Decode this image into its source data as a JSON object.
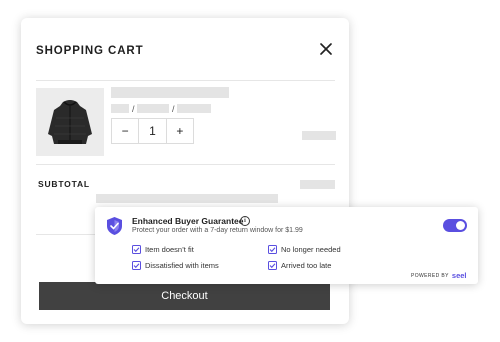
{
  "cart": {
    "title": "SHOPPING CART",
    "quantity": {
      "decrement": "−",
      "value": "1",
      "increment": "+"
    },
    "variant_separators": [
      "/",
      "/"
    ],
    "subtotal_label": "SUBTOTAL",
    "checkout_label": "Checkout"
  },
  "protection": {
    "title": "Enhanced Buyer Guarantee",
    "subtitle": "Protect your order with a 7-day return window for $1.99",
    "enabled": true,
    "benefits": [
      "Item doesn’t fit",
      "No longer needed",
      "Dissatisfied with items",
      "Arrived too late"
    ],
    "powered_by": "POWERED BY",
    "brand": "seel"
  },
  "colors": {
    "accent": "#5a4fe0",
    "button": "#414141",
    "skeleton": "#e4e4e4"
  },
  "icons": [
    "close-icon",
    "shield-icon",
    "info-icon",
    "checkbox-icon"
  ]
}
